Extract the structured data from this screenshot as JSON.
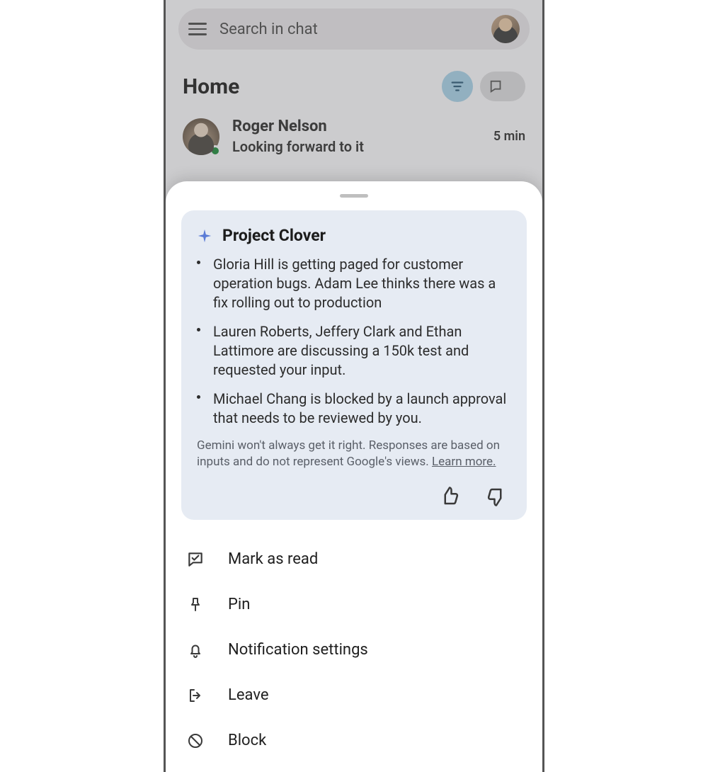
{
  "search": {
    "placeholder": "Search in chat"
  },
  "header": {
    "title": "Home"
  },
  "conversation": {
    "name": "Roger Nelson",
    "snippet": "Looking forward to it",
    "time": "5 min"
  },
  "summary": {
    "title": "Project Clover",
    "bullets": [
      "Gloria Hill is getting paged for customer operation bugs. Adam Lee thinks there was a fix rolling out to production",
      "Lauren Roberts, Jeffery Clark and Ethan Lattimore are discussing a 150k test and requested your input.",
      "Michael Chang is blocked by a launch approval that needs to be reviewed by you."
    ],
    "disclaimer": "Gemini won't always get it right. Responses are based on inputs and do not represent Google's views. ",
    "learn_more": "Learn more."
  },
  "menu": {
    "mark_read": "Mark as read",
    "pin": "Pin",
    "notifications": "Notification settings",
    "leave": "Leave",
    "block": "Block"
  }
}
